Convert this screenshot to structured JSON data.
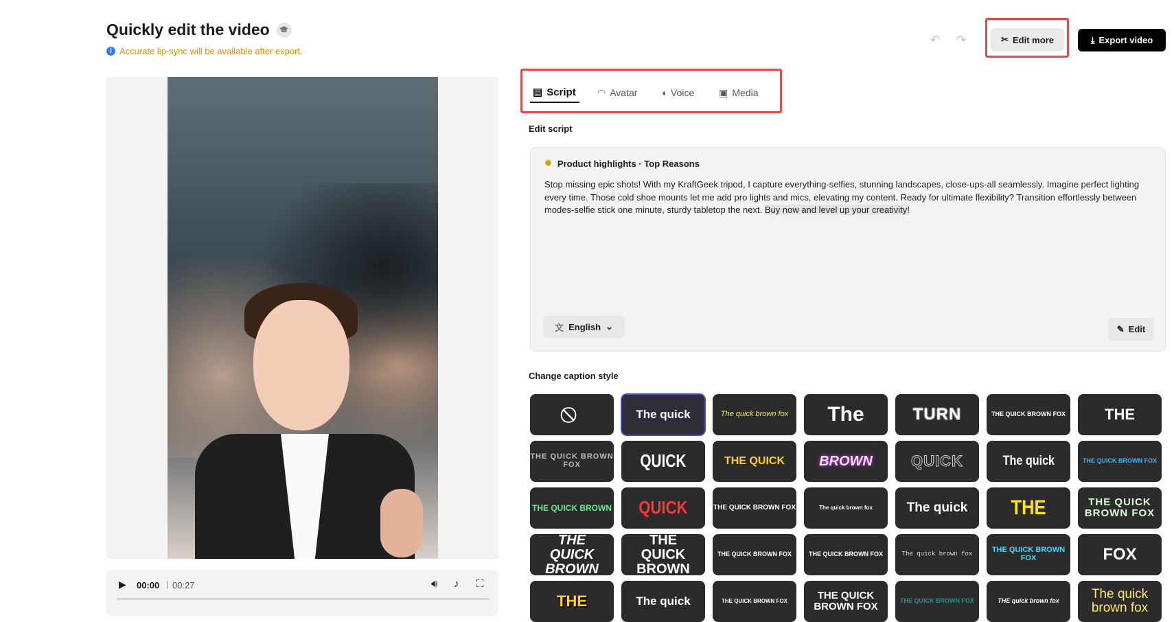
{
  "header": {
    "title": "Quickly edit the video",
    "notice": "Accurate lip-sync will be available after export.",
    "edit_more": "Edit more",
    "export": "Export video"
  },
  "player": {
    "current_time": "00:00",
    "separator": "|",
    "total_time": "00:27",
    "progress": 0
  },
  "tabs": [
    {
      "label": "Script",
      "icon": "script-icon",
      "active": true
    },
    {
      "label": "Avatar",
      "icon": "avatar-icon",
      "active": false
    },
    {
      "label": "Voice",
      "icon": "voice-icon",
      "active": false
    },
    {
      "label": "Media",
      "icon": "media-icon",
      "active": false
    }
  ],
  "script": {
    "section_label": "Edit script",
    "heading": "Product highlights · Top Reasons",
    "body": "Stop missing epic shots! With my KraftGeek tripod, I capture everything-selfies, stunning landscapes, close-ups-all seamlessly. Imagine perfect lighting every time. Those cold shoe mounts let me add pro lights and mics, elevating my content. Ready for ultimate flexibility? Transition effortlessly between modes-selfie stick one minute, sturdy tabletop the next. ",
    "body_highlight": "Buy now and level up your creativity!",
    "language": "English",
    "edit": "Edit"
  },
  "captions": {
    "label": "Change caption style",
    "styles": [
      {
        "text": "⃠",
        "style": "none"
      },
      {
        "text": "The quick",
        "style": "selected"
      },
      {
        "text": "The quick brown fox",
        "style": "yellow-italic"
      },
      {
        "text": "The",
        "style": "big-white"
      },
      {
        "text": "TURN",
        "style": "outline-white"
      },
      {
        "text": "THE QUICK BROWN FOX",
        "style": "small-caps-teal"
      },
      {
        "text": "THE",
        "style": "bold-white"
      },
      {
        "text": "THE QUICK BROWN FOX",
        "style": "mono-grey"
      },
      {
        "text": "QUICK",
        "style": "condensed-white"
      },
      {
        "text": "THE QUICK",
        "style": "yellow-bold"
      },
      {
        "text": "BROWN",
        "style": "pink-glow"
      },
      {
        "text": "QUICK",
        "style": "outline-grey"
      },
      {
        "text": "The quick",
        "style": "condensed-white-2"
      },
      {
        "text": "THE QUICK BROWN FOX",
        "style": "blue-small"
      },
      {
        "text": "THE QUICK BROWN",
        "style": "green-mix"
      },
      {
        "text": "QUICK",
        "style": "red-stroke"
      },
      {
        "text": "THE QUICK BROWN FOX",
        "style": "purple-box"
      },
      {
        "text": "The quick brown fox",
        "style": "purple-bar"
      },
      {
        "text": "The quick",
        "style": "red-white"
      },
      {
        "text": "THE",
        "style": "yellow-big"
      },
      {
        "text": "THE QUICK BROWN FOX",
        "style": "green-two-line"
      },
      {
        "text": "THE QUICK BROWN",
        "style": "purple-stack"
      },
      {
        "text": "THE QUICK BROWN",
        "style": "yellow-stack"
      },
      {
        "text": "THE QUICK BROWN FOX",
        "style": "teal-small"
      },
      {
        "text": "THE QUICK BROWN FOX",
        "style": "violet-small"
      },
      {
        "text": "The quick brown fox",
        "style": "mono-tiny"
      },
      {
        "text": "THE QUICK BROWN FOX",
        "style": "cyan-condensed"
      },
      {
        "text": "FOX",
        "style": "white-fox"
      },
      {
        "text": "THE",
        "style": "yellow-3d"
      },
      {
        "text": "The quick",
        "style": "green-last"
      },
      {
        "text": "THE QUICK BROWN FOX",
        "style": "blue-box"
      },
      {
        "text": "THE QUICK BROWN FOX",
        "style": "yellow-two-line"
      },
      {
        "text": "THE QUICK BROWN FOX",
        "style": "teal-faded"
      },
      {
        "text": "THE quick brown fox",
        "style": "cyan-italic"
      },
      {
        "text": "The quick brown fox",
        "style": "yellow-white-two-line"
      }
    ]
  },
  "colors": {
    "accent_orange": "#f08a00",
    "highlight_red": "#e44a4a",
    "tile_bg": "#2b2b2b"
  }
}
